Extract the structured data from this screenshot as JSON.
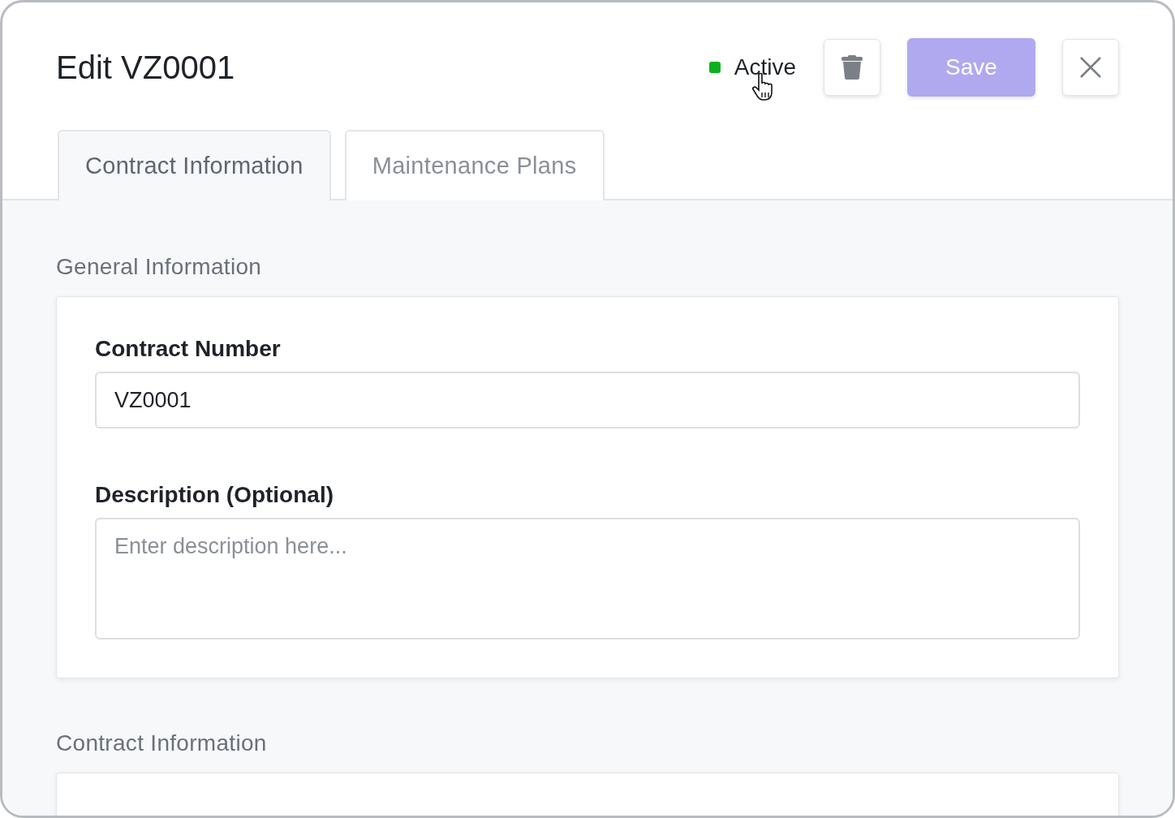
{
  "title": "Edit VZ0001",
  "status": {
    "label": "Active",
    "active": true
  },
  "delete_button": {
    "disabled": false
  },
  "save_button": {
    "label": "Save",
    "disabled": true
  },
  "tabs": [
    {
      "label": "Contract Information",
      "selected": true
    },
    {
      "label": "Maintenance Plans",
      "selected": false
    }
  ],
  "sections": [
    {
      "heading": "General Information",
      "fields": [
        {
          "kind": "input",
          "label": "Contract Number",
          "value": "VZ0001"
        },
        {
          "kind": "textarea",
          "label": "Description (Optional)",
          "placeholder": "Enter description here..."
        }
      ]
    },
    {
      "heading": "Contract Information"
    }
  ]
}
